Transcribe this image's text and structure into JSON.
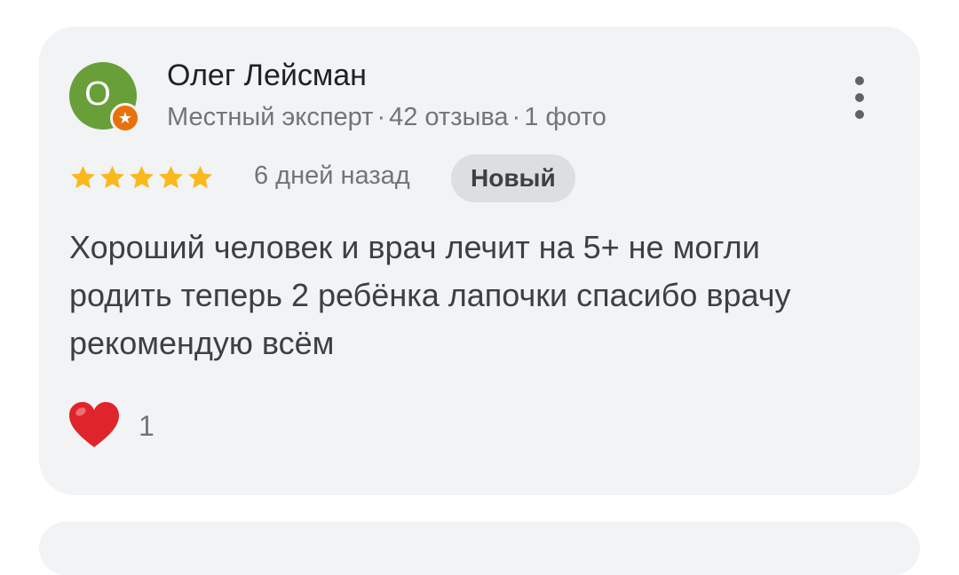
{
  "review": {
    "author": {
      "avatar_letter": "О",
      "avatar_color": "#689f38",
      "badge_icon": "star-icon",
      "name": "Олег Лейсман",
      "role": "Местный эксперт",
      "reviews_count": "42 отзыва",
      "photos_count": "1 фото",
      "separator": "·"
    },
    "menu_icon": "more-vert-icon",
    "rating": {
      "value": 5,
      "max": 5,
      "color": "#f9b91c"
    },
    "date": "6 дней назад",
    "badge": "Новый",
    "text": "Хороший человек и врач лечит на 5+ не могли родить теперь 2 ребёнка лапочки спасибо врачу рекомендую всём",
    "reaction": {
      "icon": "heart-icon",
      "color": "#e0242b",
      "count": "1"
    }
  }
}
